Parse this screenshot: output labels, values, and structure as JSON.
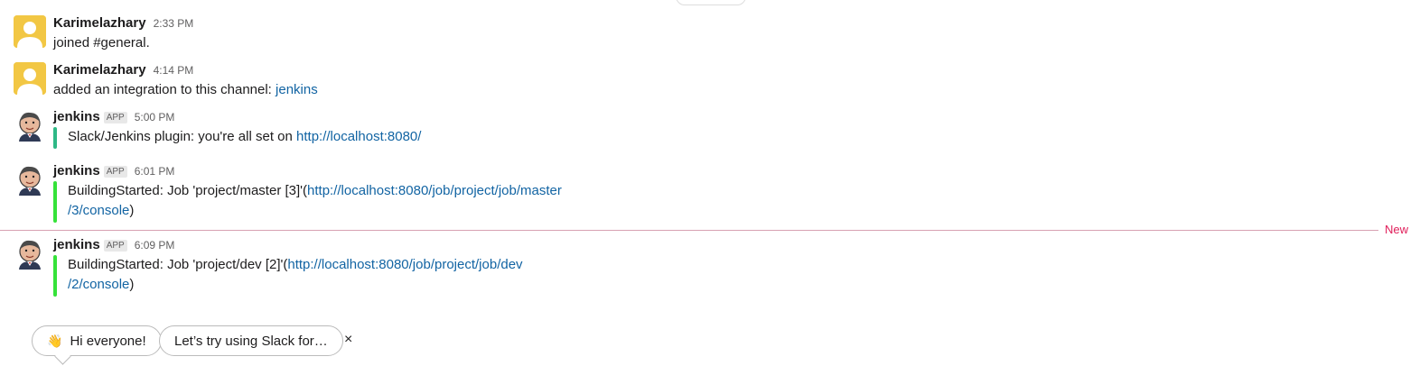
{
  "messages": [
    {
      "author": "Karimelazhary",
      "time": "2:33 PM",
      "text": "joined #general."
    },
    {
      "author": "Karimelazhary",
      "time": "4:14 PM",
      "text_prefix": "added an integration to this channel: ",
      "link": "jenkins"
    },
    {
      "author": "jenkins",
      "badge": "APP",
      "time": "5:00 PM",
      "text_prefix": "Slack/Jenkins plugin: you're all set on ",
      "link": "http://localhost:8080/",
      "bar_color": "#2eb886"
    },
    {
      "author": "jenkins",
      "badge": "APP",
      "time": "6:01 PM",
      "text_prefix": "BuildingStarted: Job 'project/master [3]'(",
      "link_line1": "http://localhost:8080/job/project/job/master",
      "link_line2": "/3/console",
      "text_suffix": ")",
      "bar_color": "#36e23a"
    },
    {
      "author": "jenkins",
      "badge": "APP",
      "time": "6:09 PM",
      "text_prefix": "BuildingStarted: Job 'project/dev [2]'(",
      "link_line1": "http://localhost:8080/job/project/job/dev",
      "link_line2": "/2/console",
      "text_suffix": ")",
      "bar_color": "#36e23a"
    }
  ],
  "new_divider_label": "New",
  "suggestions": [
    {
      "emoji": "👋",
      "label": "Hi everyone!"
    },
    {
      "label": "Let’s try using Slack for…"
    }
  ],
  "dismiss_label": "×",
  "colors": {
    "link": "#1264a3",
    "new_label": "#e01e5a",
    "user_avatar": "#f2c744"
  }
}
